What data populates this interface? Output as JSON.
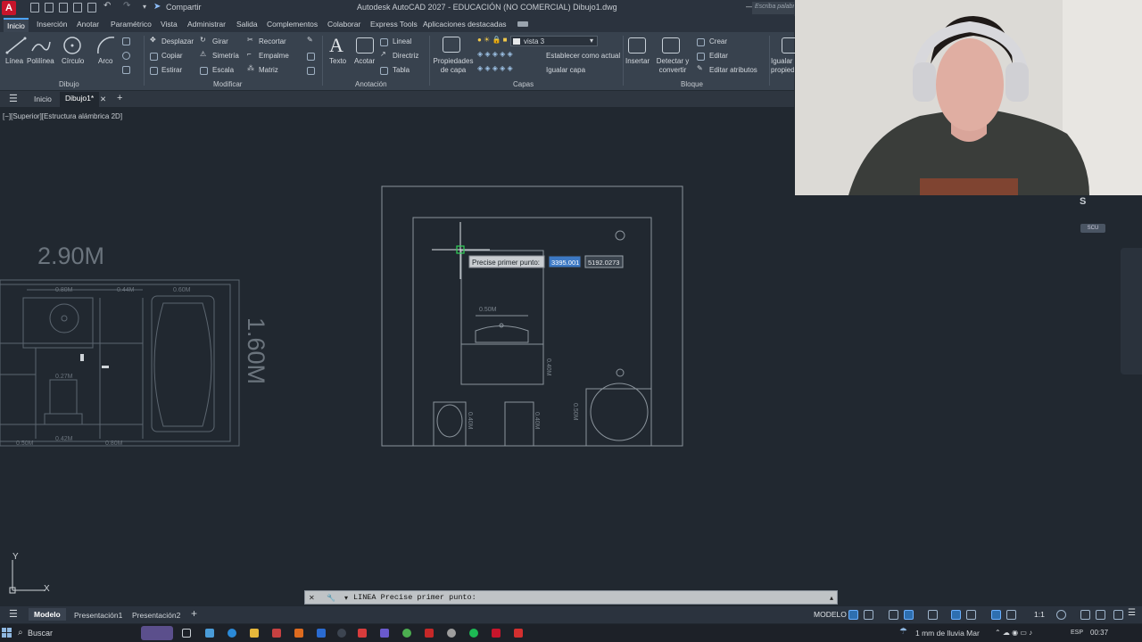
{
  "app": {
    "logo": "A",
    "share": "Compartir",
    "title": "Autodesk AutoCAD 2027 - EDUCACIÓN (NO COMERCIAL)   Dibujo1.dwg",
    "search_placeholder": "Escriba palabra clave o frase",
    "accent": "#4da3ff",
    "brand": "#c7152b"
  },
  "ribbon_tabs": [
    "Inicio",
    "Inserción",
    "Anotar",
    "Paramétrico",
    "Vista",
    "Administrar",
    "Salida",
    "Complementos",
    "Colaborar",
    "Express Tools",
    "Aplicaciones destacadas"
  ],
  "ribbon": {
    "draw": {
      "linea": "Línea",
      "polilinea": "Polilínea",
      "circulo": "Círculo",
      "arco": "Arco",
      "panel": "Dibujo"
    },
    "modify": {
      "desplazar": "Desplazar",
      "girar": "Girar",
      "recortar": "Recortar",
      "copiar": "Copiar",
      "simetria": "Simetría",
      "empalme": "Empalme",
      "estirar": "Estirar",
      "escala": "Escala",
      "matriz": "Matriz",
      "panel": "Modificar"
    },
    "annotation": {
      "texto": "Texto",
      "acotar": "Acotar",
      "lineal": "Lineal",
      "directriz": "Directriz",
      "tabla": "Tabla",
      "panel": "Anotación"
    },
    "layers": {
      "propiedades": "Propiedades de capa",
      "layer_name": "vista 3",
      "establecer": "Establecer como actual",
      "igualar": "Igualar capa",
      "panel": "Capas"
    },
    "block": {
      "insertar": "Insertar",
      "detectar": "Detectar y convertir",
      "crear": "Crear",
      "editar": "Editar",
      "editar_atributos": "Editar atributos",
      "panel": "Bloque"
    },
    "partial": "Igualar propiedades"
  },
  "file_tabs": {
    "home": "Inicio",
    "active": "Dibujo1*"
  },
  "viewport_label": "[−][Superior][Estructura alámbrica 2D]",
  "drawing": {
    "dims_left": {
      "width": "2.90M",
      "height": "1.60M",
      "d1": "0.80M",
      "d2": "0.44M",
      "d3": "0.60M",
      "d4": "0.27M",
      "d5": "0.50M",
      "d6": "0.42M",
      "d7": "0.80M"
    },
    "dims_right": {
      "sink": "0.50M",
      "side": "0.40M",
      "a": "0.40M",
      "b": "0.40M",
      "c": "0.50M"
    }
  },
  "dynamic_input": {
    "prompt": "Precise primer punto:",
    "x": "3395.001",
    "y": "5192.0273"
  },
  "viewcube": {
    "face": "S",
    "wcs": "SCU"
  },
  "ucs": {
    "x": "X",
    "y": "Y"
  },
  "command_line": {
    "text": "LINEA Precise primer punto:"
  },
  "layout_tabs": [
    "Modelo",
    "Presentación1",
    "Presentación2"
  ],
  "status": {
    "mode": "MODELO",
    "scale": "1:1"
  },
  "taskbar": {
    "search": "Buscar",
    "weather": "1 mm de lluvia Mar",
    "lang": "ESP",
    "time": "00:37"
  }
}
